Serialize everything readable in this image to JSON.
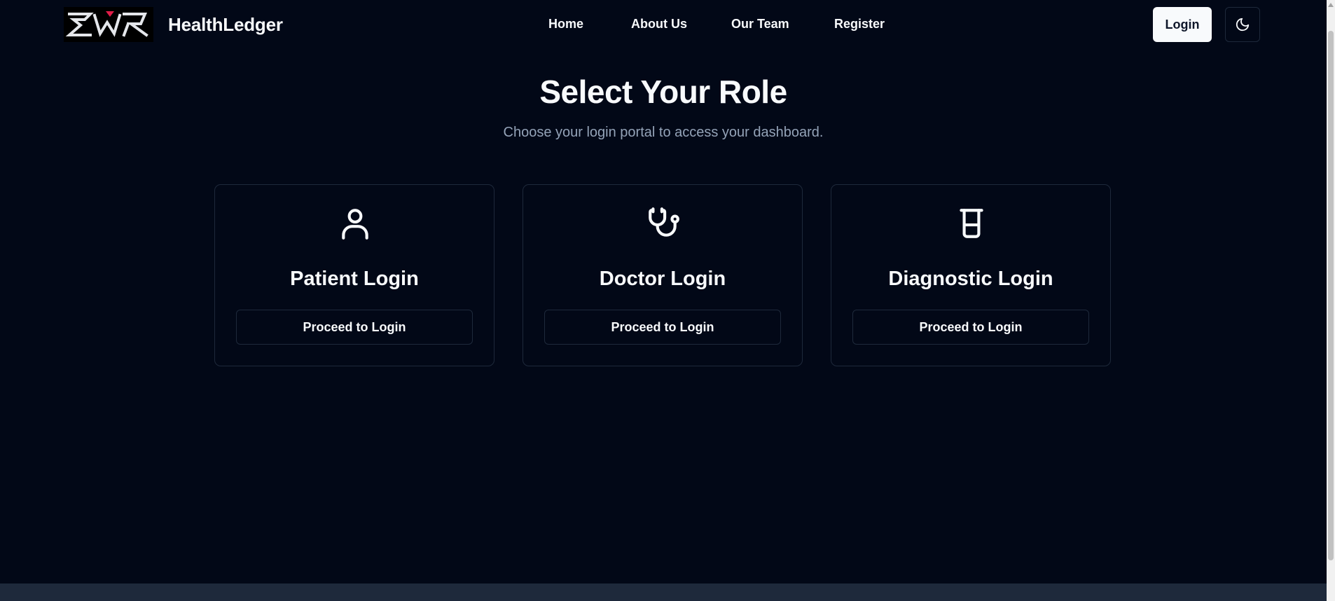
{
  "header": {
    "brand": "HealthLedger",
    "nav": [
      "Home",
      "About Us",
      "Our Team",
      "Register"
    ],
    "login_label": "Login",
    "theme_icon": "moon-icon"
  },
  "main": {
    "title": "Select Your Role",
    "subtitle": "Choose your login portal to access your dashboard.",
    "cards": [
      {
        "icon": "user-icon",
        "title": "Patient Login",
        "button": "Proceed to Login"
      },
      {
        "icon": "stethoscope-icon",
        "title": "Doctor Login",
        "button": "Proceed to Login"
      },
      {
        "icon": "test-tube-icon",
        "title": "Diagnostic Login",
        "button": "Proceed to Login"
      }
    ]
  },
  "colors": {
    "background": "#020817",
    "border": "#1e293b",
    "text": "#f8fafc",
    "muted": "#94a3b8",
    "footer": "#1e293b",
    "logo_accent": "#e11d48"
  }
}
